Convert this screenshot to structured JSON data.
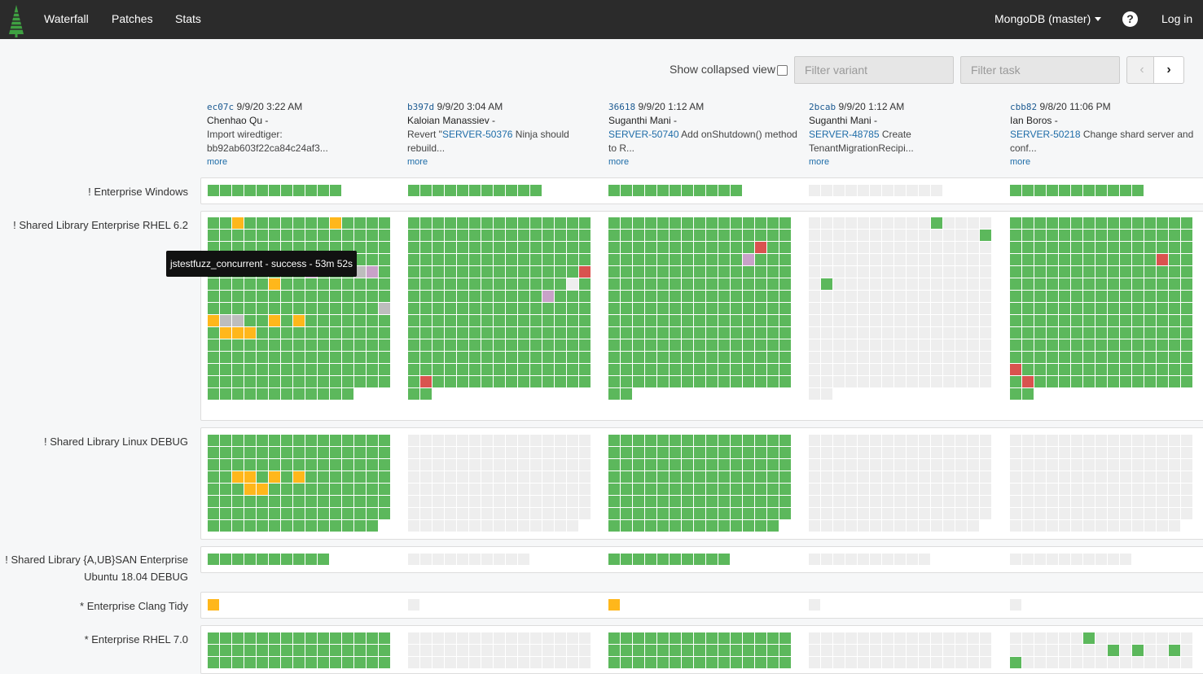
{
  "nav": {
    "items": [
      "Waterfall",
      "Patches",
      "Stats"
    ],
    "project": "MongoDB (master)",
    "help": "?",
    "login": "Log in"
  },
  "controls": {
    "collapsed_label": "Show collapsed view",
    "filter_variant_placeholder": "Filter variant",
    "filter_task_placeholder": "Filter task",
    "prev": "‹",
    "next": "›"
  },
  "colors": {
    "success": "#5cb85c",
    "failed": "#d9534f",
    "system_failed": "#c8a2c8",
    "setup_failed": "#f0ad4e",
    "undispatched": "#eeeeee",
    "inactive": "#bdbdbd",
    "warning": "#ffb71b"
  },
  "commits": [
    {
      "hash": "ec07c",
      "date": "9/9/20 3:22 AM",
      "author": "Chenhao Qu -",
      "msg1": "Import wiredtiger:",
      "msg2": "bb92ab603f22ca84c24af3...",
      "ticket": "",
      "more": "more"
    },
    {
      "hash": "b397d",
      "date": "9/9/20 3:04 AM",
      "author": "Kaloian Manassiev -",
      "msg1_pre": "Revert \"",
      "ticket": "SERVER-50376",
      "msg1": " Ninja should",
      "msg2": "rebuild...",
      "more": "more"
    },
    {
      "hash": "36618",
      "date": "9/9/20 1:12 AM",
      "author": "Suganthi Mani -",
      "ticket": "SERVER-50740",
      "msg1": " Add onShutdown() method",
      "msg2": "to R...",
      "more": "more"
    },
    {
      "hash": "2bcab",
      "date": "9/9/20 1:12 AM",
      "author": "Suganthi Mani -",
      "ticket": "SERVER-48785",
      "msg1": " Create",
      "msg2": "TenantMigrationRecipi...",
      "more": "more"
    },
    {
      "hash": "cbb82",
      "date": "9/8/20 11:06 PM",
      "author": "Ian Boros -",
      "ticket": "SERVER-50218",
      "msg1": " Change shard server and",
      "msg2": "conf...",
      "more": "more"
    }
  ],
  "variants": [
    {
      "name": "! Enterprise Windows",
      "builds": [
        {
          "total": 11,
          "default": "success",
          "special": []
        },
        {
          "total": 11,
          "default": "success",
          "special": []
        },
        {
          "total": 11,
          "default": "success",
          "special": []
        },
        {
          "total": 11,
          "default": "undispatched",
          "special": []
        },
        {
          "total": 11,
          "default": "success",
          "special": []
        }
      ]
    },
    {
      "name": "! Shared Library Enterprise RHEL 6.2",
      "builds": [
        {
          "total": 222,
          "default": "success",
          "special": [
            [
              2,
              "warning"
            ],
            [
              10,
              "warning"
            ],
            [
              51,
              "warning"
            ],
            [
              68,
              "system_failed"
            ],
            [
              72,
              "inactive"
            ],
            [
              73,
              "system_failed"
            ],
            [
              80,
              "warning"
            ],
            [
              119,
              "inactive"
            ],
            [
              120,
              "warning"
            ],
            [
              121,
              "inactive"
            ],
            [
              122,
              "inactive"
            ],
            [
              125,
              "warning"
            ],
            [
              127,
              "warning"
            ],
            [
              136,
              "warning"
            ],
            [
              137,
              "warning"
            ],
            [
              138,
              "warning"
            ],
            [
              224,
              "inactive"
            ]
          ]
        },
        {
          "total": 212,
          "default": "success",
          "special": [
            [
              74,
              "failed"
            ],
            [
              88,
              "undispatched"
            ],
            [
              101,
              "system_failed"
            ],
            [
              196,
              "failed"
            ]
          ]
        },
        {
          "total": 212,
          "default": "success",
          "special": [
            [
              42,
              "failed"
            ],
            [
              56,
              "system_failed"
            ]
          ]
        },
        {
          "total": 212,
          "default": "undispatched",
          "special": [
            [
              10,
              "success"
            ],
            [
              29,
              "success"
            ],
            [
              76,
              "success"
            ]
          ]
        },
        {
          "total": 212,
          "default": "success",
          "special": [
            [
              57,
              "failed"
            ],
            [
              180,
              "failed"
            ],
            [
              196,
              "failed"
            ]
          ]
        }
      ]
    },
    {
      "name": "! Shared Library Linux DEBUG",
      "builds": [
        {
          "total": 119,
          "default": "success",
          "special": [
            [
              47,
              "warning"
            ],
            [
              48,
              "warning"
            ],
            [
              50,
              "warning"
            ],
            [
              52,
              "warning"
            ],
            [
              63,
              "warning"
            ],
            [
              64,
              "warning"
            ]
          ]
        },
        {
          "total": 119,
          "default": "undispatched",
          "special": []
        },
        {
          "total": 119,
          "default": "success",
          "special": []
        },
        {
          "total": 119,
          "default": "undispatched",
          "special": []
        },
        {
          "total": 119,
          "default": "undispatched",
          "special": []
        }
      ]
    },
    {
      "name": "! Shared Library {A,UB}SAN Enterprise Ubuntu 18.04 DEBUG",
      "builds": [
        {
          "total": 10,
          "default": "success",
          "special": []
        },
        {
          "total": 10,
          "default": "undispatched",
          "special": []
        },
        {
          "total": 10,
          "default": "success",
          "special": []
        },
        {
          "total": 10,
          "default": "undispatched",
          "special": []
        },
        {
          "total": 10,
          "default": "undispatched",
          "special": []
        }
      ]
    },
    {
      "name": "* Enterprise Clang Tidy",
      "builds": [
        {
          "total": 1,
          "default": "warning",
          "special": []
        },
        {
          "total": 1,
          "default": "undispatched",
          "special": []
        },
        {
          "total": 1,
          "default": "warning",
          "special": []
        },
        {
          "total": 1,
          "default": "undispatched",
          "special": []
        },
        {
          "total": 1,
          "default": "undispatched",
          "special": []
        }
      ]
    },
    {
      "name": "* Enterprise RHEL 7.0",
      "builds": [
        {
          "total": 45,
          "default": "success",
          "special": []
        },
        {
          "total": 45,
          "default": "undispatched",
          "special": []
        },
        {
          "total": 45,
          "default": "success",
          "special": []
        },
        {
          "total": 45,
          "default": "undispatched",
          "special": []
        },
        {
          "total": 45,
          "default": "undispatched",
          "special": [
            [
              6,
              "success"
            ],
            [
              23,
              "success"
            ],
            [
              25,
              "success"
            ],
            [
              28,
              "success"
            ],
            [
              30,
              "success"
            ]
          ]
        }
      ]
    }
  ],
  "tooltip": "jstestfuzz_concurrent - success - 53m 52s"
}
